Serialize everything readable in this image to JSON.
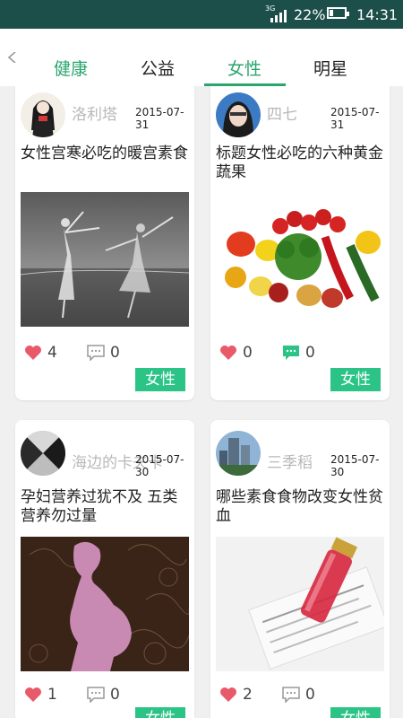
{
  "status_bar": {
    "network": "3G",
    "battery_percent": "22%",
    "time": "14:31"
  },
  "tabs": [
    {
      "label": "健康",
      "active": false
    },
    {
      "label": "公益",
      "active": false
    },
    {
      "label": "女性",
      "active": true
    },
    {
      "label": "明星",
      "active": false
    }
  ],
  "posts": [
    {
      "author": "洛利塔",
      "date": "2015-07-31",
      "title": "女性宫寒必吃的暖宫素食",
      "likes": "4",
      "comments": "0",
      "tag": "女性"
    },
    {
      "author": "四七",
      "date": "2015-07-31",
      "title": "标题女性必吃的六种黄金蔬果",
      "likes": "0",
      "comments": "0",
      "tag": "女性"
    },
    {
      "author": "海边的卡夫卡",
      "date": "2015-07-30",
      "title": "孕妇营养过犹不及 五类营养勿过量",
      "likes": "1",
      "comments": "0",
      "tag": "女性"
    },
    {
      "author": "三季稻",
      "date": "2015-07-30",
      "title": "哪些素食食物改变女性贫血",
      "likes": "2",
      "comments": "0",
      "tag": "女性"
    }
  ],
  "colors": {
    "accent": "#2aa66d",
    "tag_bg": "#2bc486",
    "like": "#e85a6a",
    "status_bar": "#1c4e4a"
  }
}
